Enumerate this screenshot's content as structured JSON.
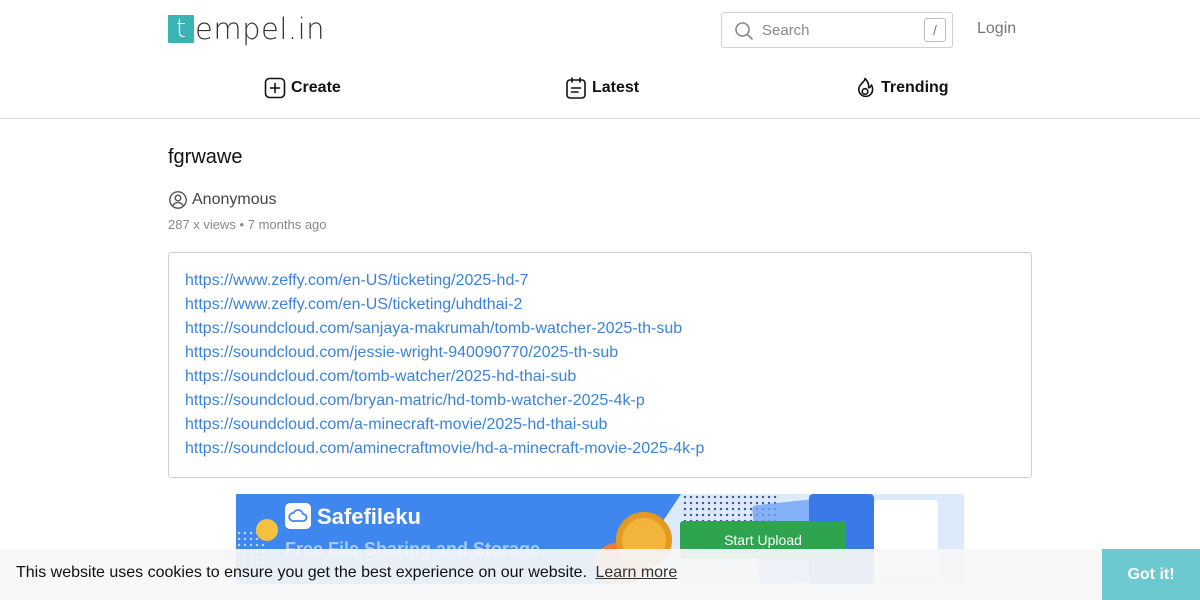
{
  "header": {
    "logo_letter": "t",
    "logo_rest": "empel.in",
    "search": {
      "placeholder": "Search",
      "shortcut": "/"
    },
    "login_label": "Login"
  },
  "nav": [
    {
      "label": "Create",
      "icon": "plus-square-icon"
    },
    {
      "label": "Latest",
      "icon": "clipboard-icon"
    },
    {
      "label": "Trending",
      "icon": "flame-icon"
    }
  ],
  "paste": {
    "title": "fgrwawe",
    "author": "Anonymous",
    "views": "287 x views",
    "separator": "•",
    "age": "7 months ago",
    "links": [
      "https://www.zeffy.com/en-US/ticketing/2025-hd-7",
      "https://www.zeffy.com/en-US/ticketing/uhdthai-2",
      "https://soundcloud.com/sanjaya-makrumah/tomb-watcher-2025-th-sub",
      "https://soundcloud.com/jessie-wright-940090770/2025-th-sub",
      "https://soundcloud.com/tomb-watcher/2025-hd-thai-sub",
      "https://soundcloud.com/bryan-matric/hd-tomb-watcher-2025-4k-p",
      "https://soundcloud.com/a-minecraft-movie/2025-hd-thai-sub",
      "https://soundcloud.com/aminecraftmovie/hd-a-minecraft-movie-2025-4k-p"
    ]
  },
  "ad": {
    "brand": "Safefileku",
    "tagline": "Free File Sharing and Storage",
    "button": "Start Upload"
  },
  "cookie": {
    "message": "This website uses cookies to ensure you get the best experience on our website.",
    "learn_more": "Learn more",
    "accept": "Got it!"
  },
  "colors": {
    "brand": "#3ab3b3",
    "link": "#3d82d6",
    "cookie_button": "#6cc9cf",
    "ad_background": "#3f87ef"
  }
}
